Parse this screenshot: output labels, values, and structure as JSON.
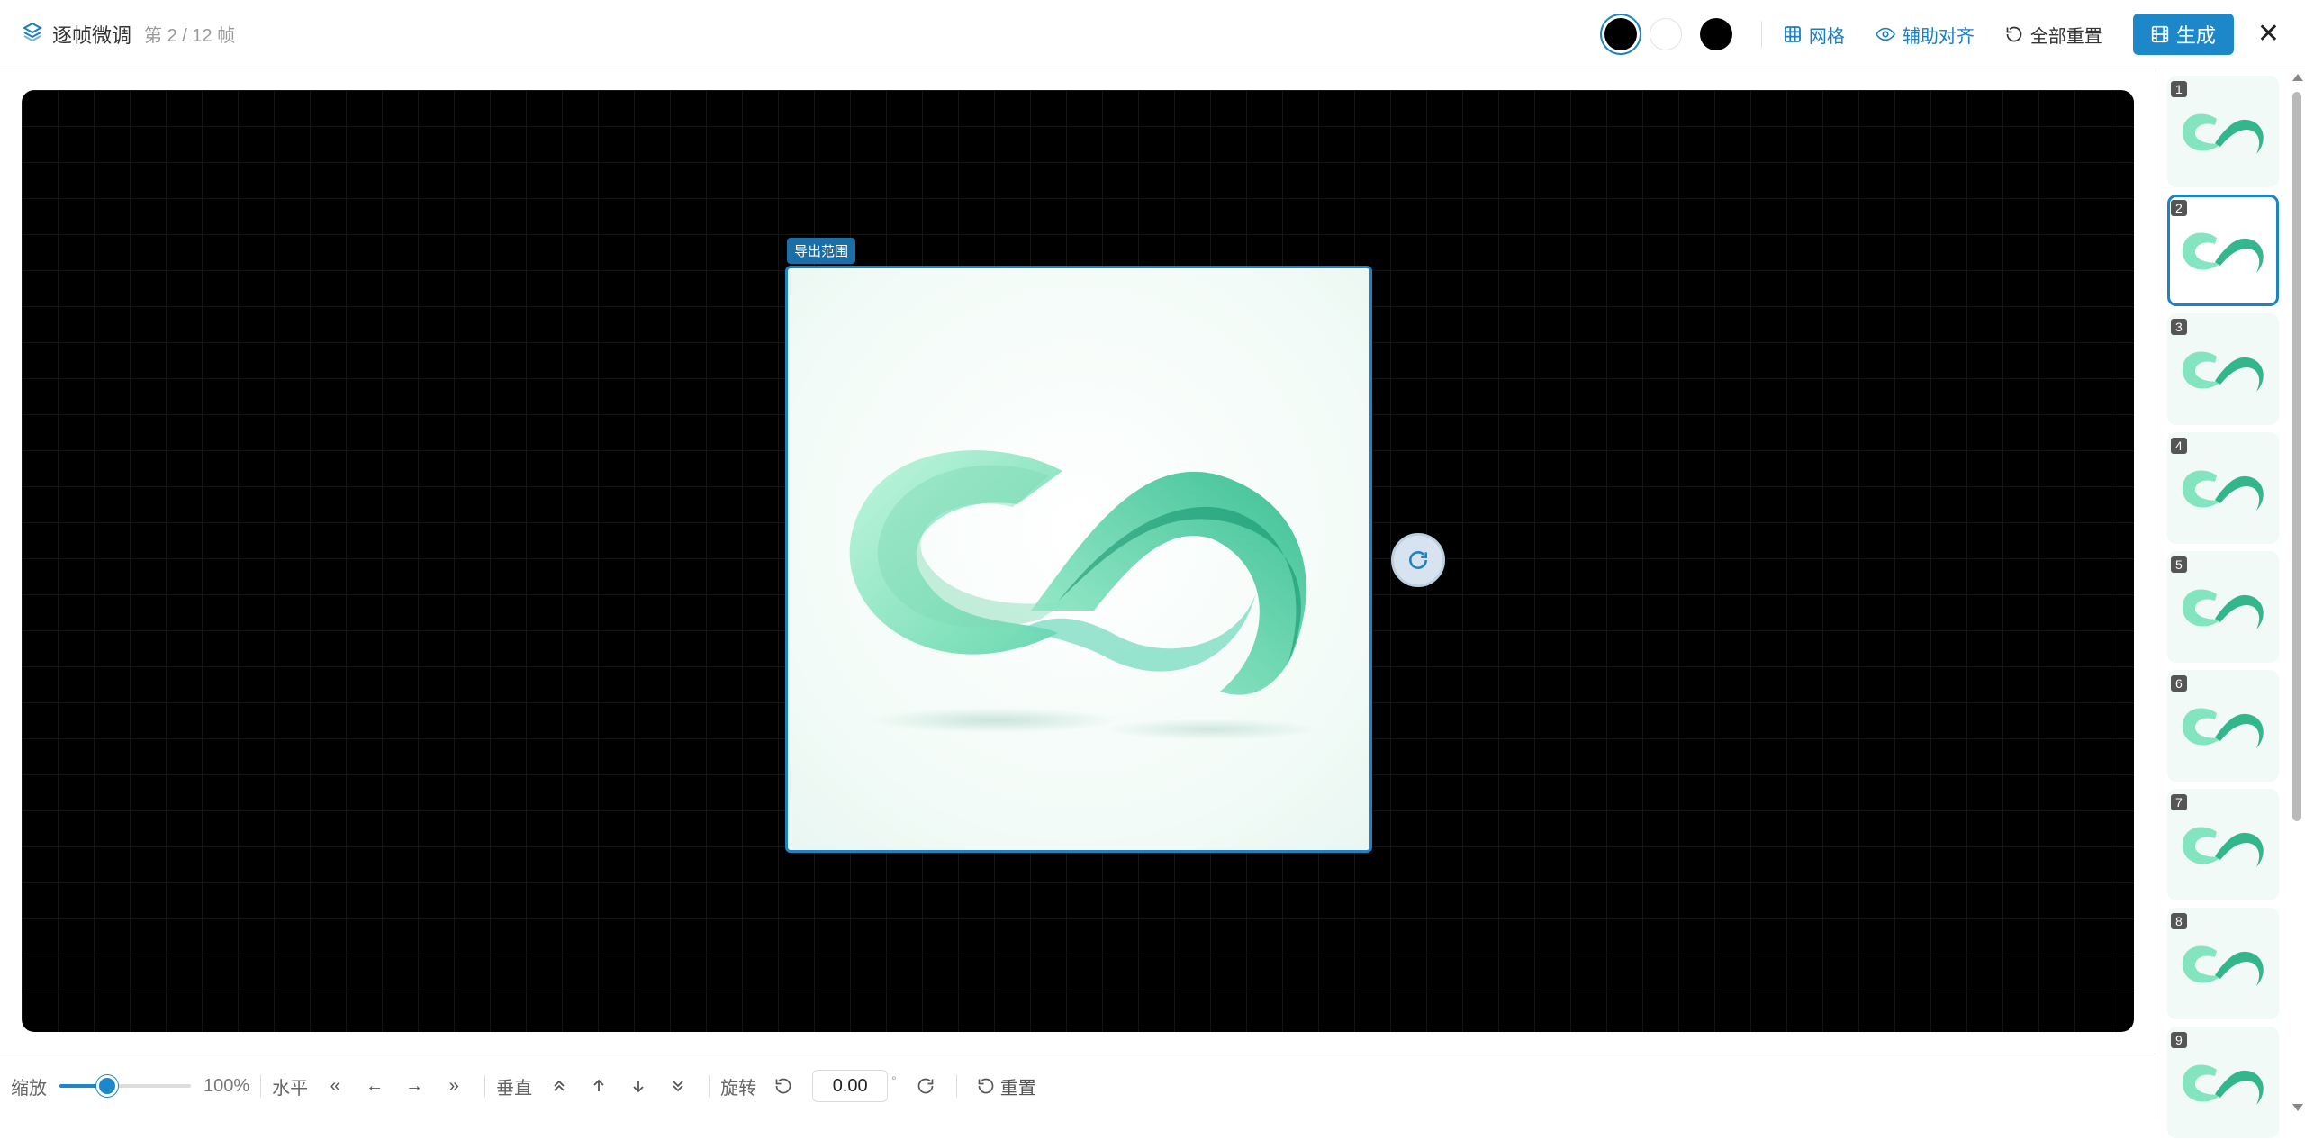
{
  "header": {
    "title": "逐帧微调",
    "frame_info": "第 2 / 12 帧",
    "grid_label": "网格",
    "guides_label": "辅助对齐",
    "reset_all_label": "全部重置",
    "generate_label": "生成",
    "close_label": "✕",
    "swatch_colors": [
      "#000000",
      "#ffffff",
      "#000000"
    ]
  },
  "canvas": {
    "export_label": "导出范围",
    "accent_color": "#1f82c4"
  },
  "thumbnails": [
    {
      "num": "1",
      "active": false
    },
    {
      "num": "2",
      "active": true
    },
    {
      "num": "3",
      "active": false
    },
    {
      "num": "4",
      "active": false
    },
    {
      "num": "5",
      "active": false
    },
    {
      "num": "6",
      "active": false
    },
    {
      "num": "7",
      "active": false
    },
    {
      "num": "8",
      "active": false
    },
    {
      "num": "9",
      "active": false
    }
  ],
  "bottom": {
    "zoom_label": "缩放",
    "zoom_value": "100%",
    "zoom_fraction": 0.36,
    "horizontal_label": "水平",
    "vertical_label": "垂直",
    "rotate_label": "旋转",
    "rotation_value": "0.00",
    "degree_symbol": "°",
    "reset_label": "重置",
    "h_icons": [
      "«",
      "←",
      "→",
      "»"
    ],
    "v_icons": [
      "double-up-icon",
      "up-icon",
      "down-icon",
      "double-down-icon"
    ]
  }
}
